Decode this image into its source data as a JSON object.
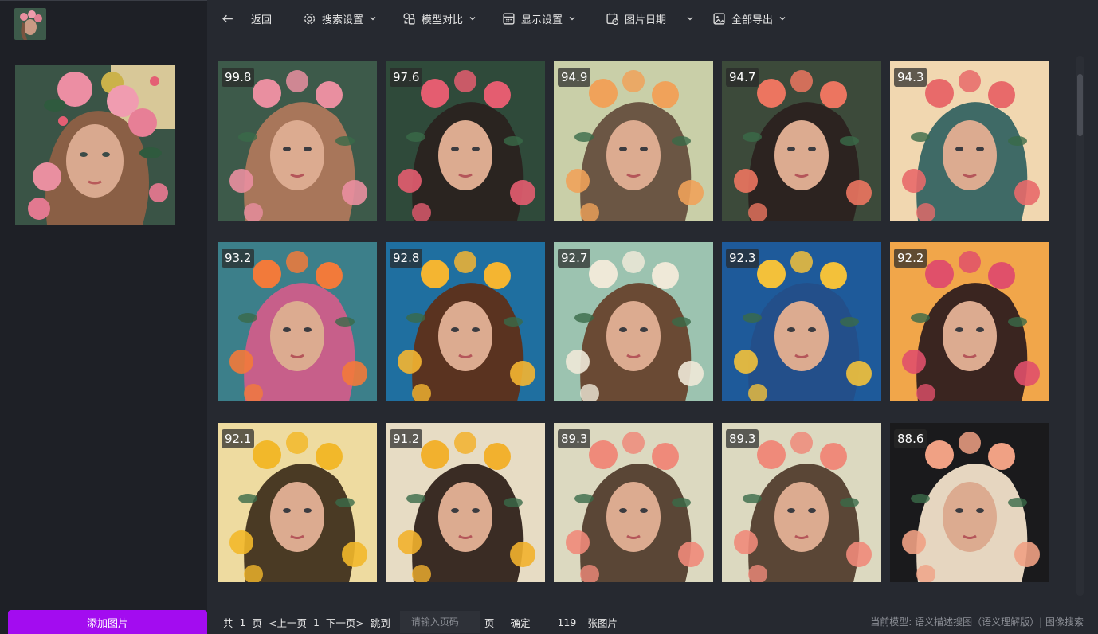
{
  "toolbar": {
    "back": "返回",
    "search_settings": "搜索设置",
    "model_compare": "模型对比",
    "display_settings": "显示设置",
    "image_date": "图片日期",
    "export_all": "全部导出"
  },
  "sidebar": {
    "add_image": "添加图片"
  },
  "results": [
    {
      "score": "99.8",
      "palette": [
        "#3d5a4a",
        "#e98fa0",
        "#a8765a"
      ]
    },
    {
      "score": "97.6",
      "palette": [
        "#2f4a3a",
        "#e45d70",
        "#2a2420"
      ]
    },
    {
      "score": "94.9",
      "palette": [
        "#c9cfa8",
        "#f0a25a",
        "#6b5644"
      ]
    },
    {
      "score": "94.7",
      "palette": [
        "#3c4a3a",
        "#ec7560",
        "#2c2320"
      ]
    },
    {
      "score": "94.3",
      "palette": [
        "#f1d7b0",
        "#e86a6a",
        "#3f6a66"
      ]
    },
    {
      "score": "93.2",
      "palette": [
        "#3c7f8a",
        "#f27a3a",
        "#c75f8a"
      ]
    },
    {
      "score": "92.8",
      "palette": [
        "#1f6fa0",
        "#f4b531",
        "#5a3320"
      ]
    },
    {
      "score": "92.7",
      "palette": [
        "#9cc3b0",
        "#efe9d8",
        "#6a4a34"
      ]
    },
    {
      "score": "92.3",
      "palette": [
        "#1e5a9a",
        "#f3c13a",
        "#234f8a"
      ]
    },
    {
      "score": "92.2",
      "palette": [
        "#f1a64a",
        "#e0506a",
        "#3a2520"
      ]
    },
    {
      "score": "92.1",
      "palette": [
        "#eedba0",
        "#f2b82a",
        "#4a3a24"
      ]
    },
    {
      "score": "91.2",
      "palette": [
        "#e7dcc4",
        "#f2b12e",
        "#3a2c24"
      ]
    },
    {
      "score": "89.3",
      "palette": [
        "#dcd9c0",
        "#ef8a7a",
        "#5a4636"
      ]
    },
    {
      "score": "89.3",
      "palette": [
        "#dcd9c0",
        "#ef8a7a",
        "#5a4636"
      ]
    },
    {
      "score": "88.6",
      "palette": [
        "#1a1a1c",
        "#f0a184",
        "#e6d6c0"
      ]
    }
  ],
  "pager": {
    "total_prefix": "共",
    "total_pages": "1",
    "page_suffix": "页",
    "prev": "<上一页",
    "current": "1",
    "next": "下一页>",
    "jump": "跳到",
    "input_placeholder": "请输入页码",
    "jump_suffix": "页",
    "confirm": "确定",
    "count": "119",
    "count_suffix": "张图片"
  },
  "footer": {
    "model_info": "当前模型: 语义描述搜图（语义理解版）| 图像搜索"
  }
}
